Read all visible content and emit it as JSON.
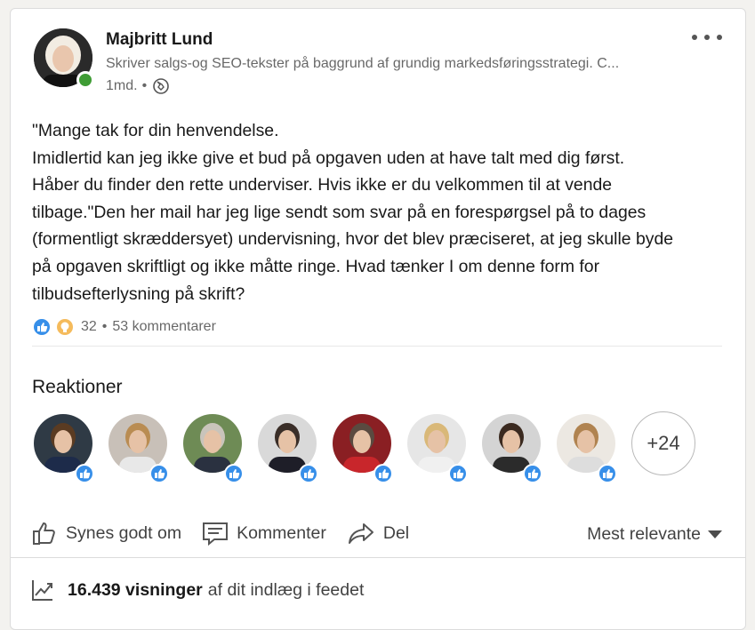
{
  "author": {
    "name": "Majbritt Lund",
    "headline": "Skriver salgs-og SEO-tekster på baggrund af grundig markedsføringsstrategi. C...",
    "time": "1md.",
    "dot": "•",
    "visibility_icon": "globe-icon"
  },
  "post": {
    "lines": [
      "\"Mange tak for din henvendelse.",
      "Imidlertid kan jeg ikke give et bud på opgaven uden at have talt med dig først.",
      "Håber du finder den rette underviser. Hvis ikke er du velkommen til at vende",
      "tilbage.\"Den her mail har jeg lige sendt som svar på en forespørgsel på to dages",
      "(formentligt skræddersyet) undervisning, hvor det blev præciseret, at jeg skulle byde",
      "på opgaven skriftligt og ikke måtte ringe. Hvad tænker I om denne form for",
      "tilbudsefterlysning på skrift?"
    ]
  },
  "social": {
    "reaction_count": "32",
    "separator": "•",
    "comments": "53 kommentarer"
  },
  "reactions": {
    "title": "Reaktioner",
    "more": "+24",
    "avatars": [
      {
        "bg": "#2f3a45",
        "hair": "#5a3b22",
        "shirt": "#1d2b4a"
      },
      {
        "bg": "#c8c0b8",
        "hair": "#b98c52",
        "shirt": "#e8e8e8"
      },
      {
        "bg": "#6e8b55",
        "hair": "#c9c4bb",
        "shirt": "#2a3140"
      },
      {
        "bg": "#d9d9d9",
        "hair": "#3a2e28",
        "shirt": "#1e1e28"
      },
      {
        "bg": "#8a1f23",
        "hair": "#5a4a40",
        "shirt": "#c8262b"
      },
      {
        "bg": "#e6e6e6",
        "hair": "#d9b878",
        "shirt": "#f0f0f0"
      },
      {
        "bg": "#d4d4d4",
        "hair": "#3b2a20",
        "shirt": "#2b2b2b"
      },
      {
        "bg": "#ece8e2",
        "hair": "#b08350",
        "shirt": "#dddddd"
      }
    ]
  },
  "actions": {
    "like": "Synes godt om",
    "comment": "Kommenter",
    "share": "Del",
    "sort": "Mest relevante"
  },
  "analytics": {
    "views": "16.439 visninger",
    "suffix": "af dit indlæg i feedet"
  },
  "colors": {
    "like_blue": "#378fe9",
    "presence_green": "#3f9c35"
  }
}
